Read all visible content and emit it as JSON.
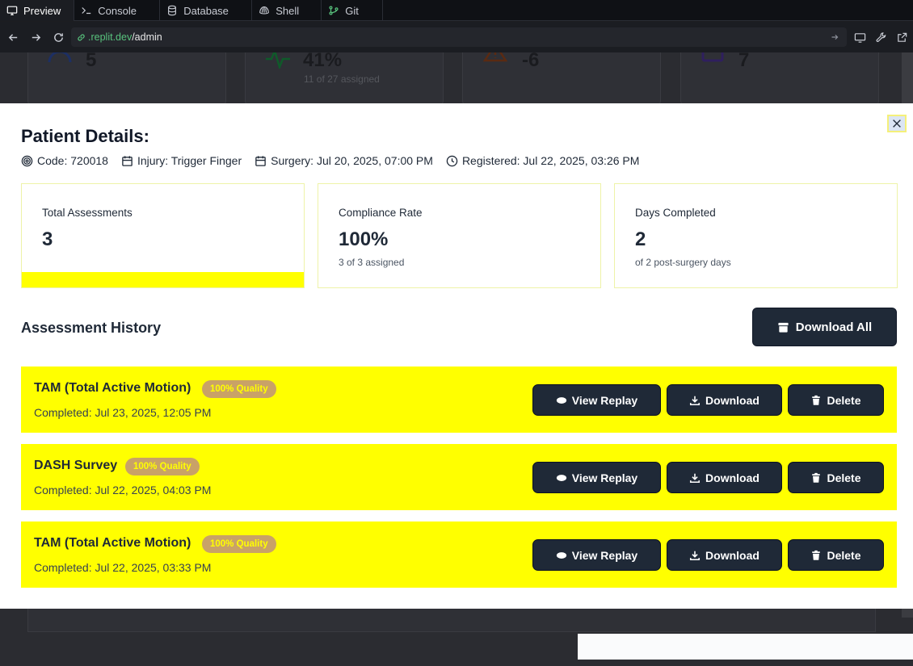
{
  "tabs": [
    {
      "label": "Preview",
      "icon": "monitor-icon"
    },
    {
      "label": "Console",
      "icon": "terminal-icon"
    },
    {
      "label": "Database",
      "icon": "database-icon"
    },
    {
      "label": "Shell",
      "icon": "shell-icon"
    },
    {
      "label": "Git",
      "icon": "git-icon"
    }
  ],
  "urlbar": {
    "host": ".replit.dev",
    "path": "/admin"
  },
  "background": {
    "stats": [
      {
        "value": "5"
      },
      {
        "value": "41%",
        "sub": "11 of 27 assigned"
      },
      {
        "value": "-6"
      },
      {
        "value": "7"
      }
    ]
  },
  "modal": {
    "title": "Patient Details:",
    "meta": {
      "code": "Code: 720018",
      "injury": "Injury: Trigger Finger",
      "surgery": "Surgery: Jul 20, 2025, 07:00 PM",
      "registered": "Registered: Jul 22, 2025, 03:26 PM"
    },
    "stats": [
      {
        "label": "Total Assessments",
        "value": "3",
        "sub": ""
      },
      {
        "label": "Compliance Rate",
        "value": "100%",
        "sub": "3 of 3 assigned"
      },
      {
        "label": "Days Completed",
        "value": "2",
        "sub": "of 2 post-surgery days"
      }
    ],
    "history_title": "Assessment History",
    "download_all": "Download All",
    "assessments": [
      {
        "name": "TAM (Total Active Motion)",
        "badge": "100% Quality",
        "completed": "Completed: Jul 23, 2025, 12:05 PM"
      },
      {
        "name": "DASH Survey",
        "badge": "100% Quality",
        "completed": "Completed: Jul 22, 2025, 04:03 PM"
      },
      {
        "name": "TAM (Total Active Motion)",
        "badge": "100% Quality",
        "completed": "Completed: Jul 22, 2025, 03:33 PM"
      }
    ],
    "buttons": {
      "view_replay": "View Replay",
      "download": "Download",
      "delete": "Delete"
    }
  }
}
